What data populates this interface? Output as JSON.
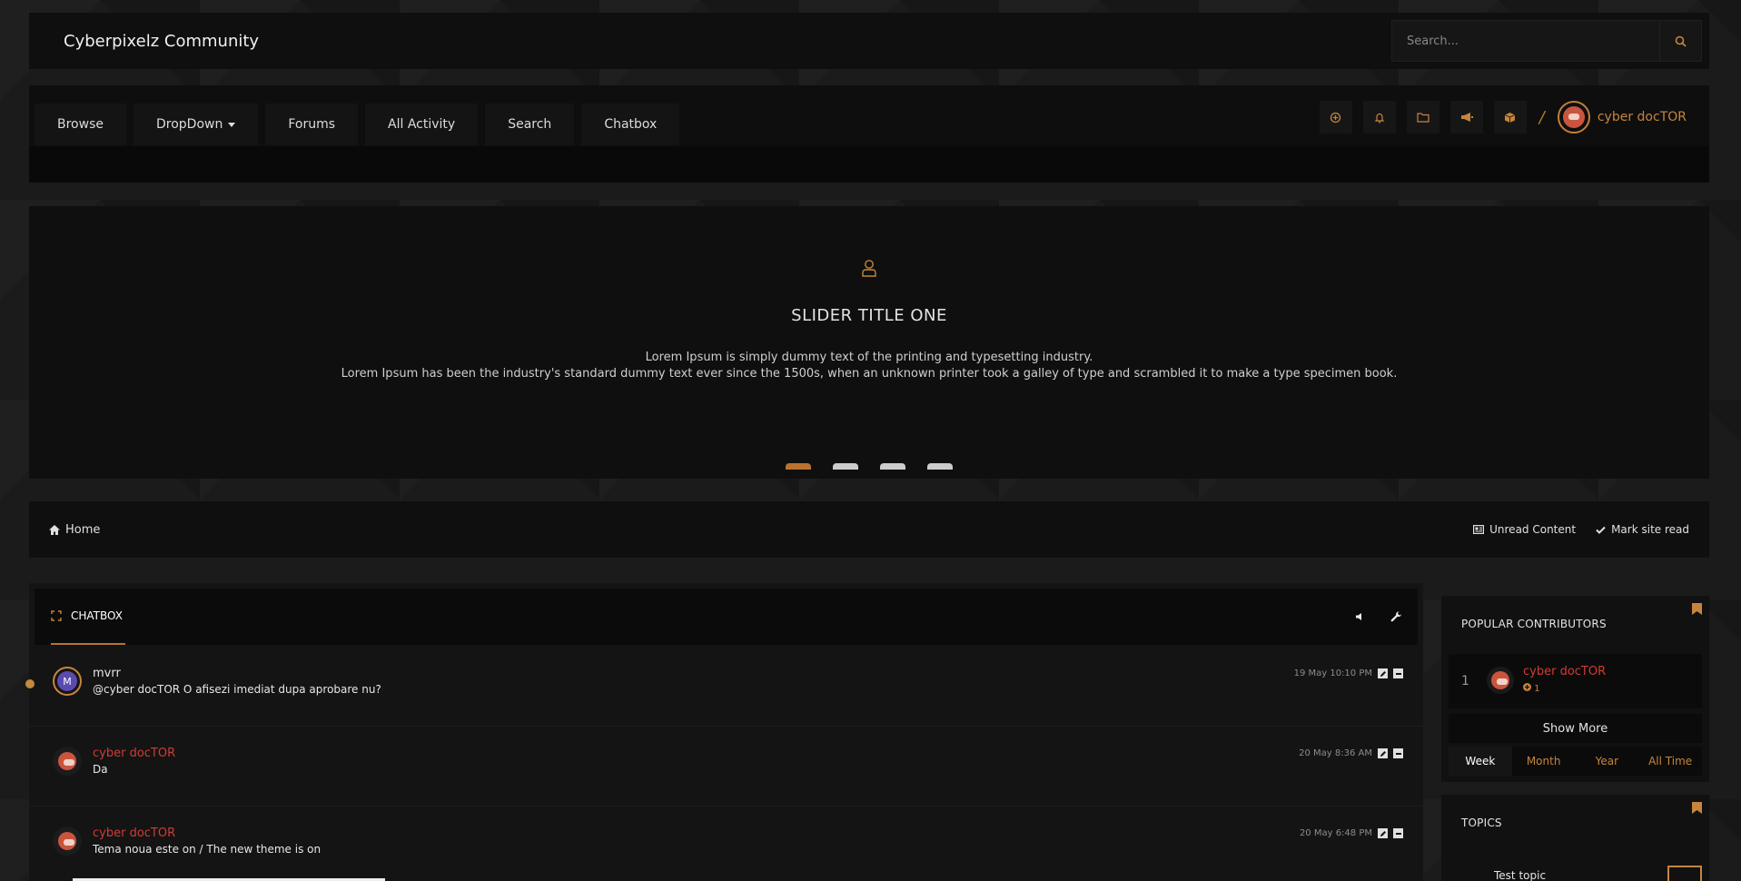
{
  "header": {
    "site_title": "Cyberpixelz Community",
    "search_placeholder": "Search..."
  },
  "nav": {
    "tabs": [
      {
        "label": "Browse"
      },
      {
        "label": "DropDown"
      },
      {
        "label": "Forums"
      },
      {
        "label": "All Activity"
      },
      {
        "label": "Search"
      },
      {
        "label": "Chatbox"
      }
    ],
    "user_name": "cyber docTOR",
    "tool_icons": [
      "create-icon",
      "bell-icon",
      "folder-icon",
      "megaphone-icon",
      "box-icon"
    ]
  },
  "slider": {
    "title": "SLIDER TITLE ONE",
    "line1": "Lorem Ipsum is simply dummy text of the printing and typesetting industry.",
    "line2": "Lorem Ipsum has been the industry's standard dummy text ever since the 1500s, when an unknown printer took a galley of type and scrambled it to make a type specimen book.",
    "slide_count": 4,
    "active_slide": 1
  },
  "breadcrumb": {
    "home": "Home",
    "unread": "Unread Content",
    "mark_read": "Mark site read"
  },
  "chatbox": {
    "title": "CHATBOX",
    "messages": [
      {
        "author": "mvrr",
        "text": "@cyber docTOR O afisezi imediat dupa aprobare nu?",
        "time": "19 May 10:10 PM",
        "avatar_letter": "M"
      },
      {
        "author": "cyber docTOR",
        "text": "Da",
        "time": "20 May 8:36 AM"
      },
      {
        "author": "cyber docTOR",
        "text": "Tema noua este on / The new theme is on",
        "time": "20 May 6:48 PM"
      }
    ]
  },
  "sidebar": {
    "popular": {
      "title": "POPULAR CONTRIBUTORS",
      "rank": "1",
      "name": "cyber docTOR",
      "rep": "1",
      "show_more": "Show More",
      "periods": [
        "Week",
        "Month",
        "Year",
        "All Time"
      ],
      "active_period": "Week"
    },
    "topics": {
      "title": "TOPICS",
      "first_topic": "Test topic"
    }
  },
  "colors": {
    "accent": "#b8732f",
    "author_red": "#d23b35",
    "panel": "#0f0f0f",
    "background": "#1b1b1b"
  }
}
